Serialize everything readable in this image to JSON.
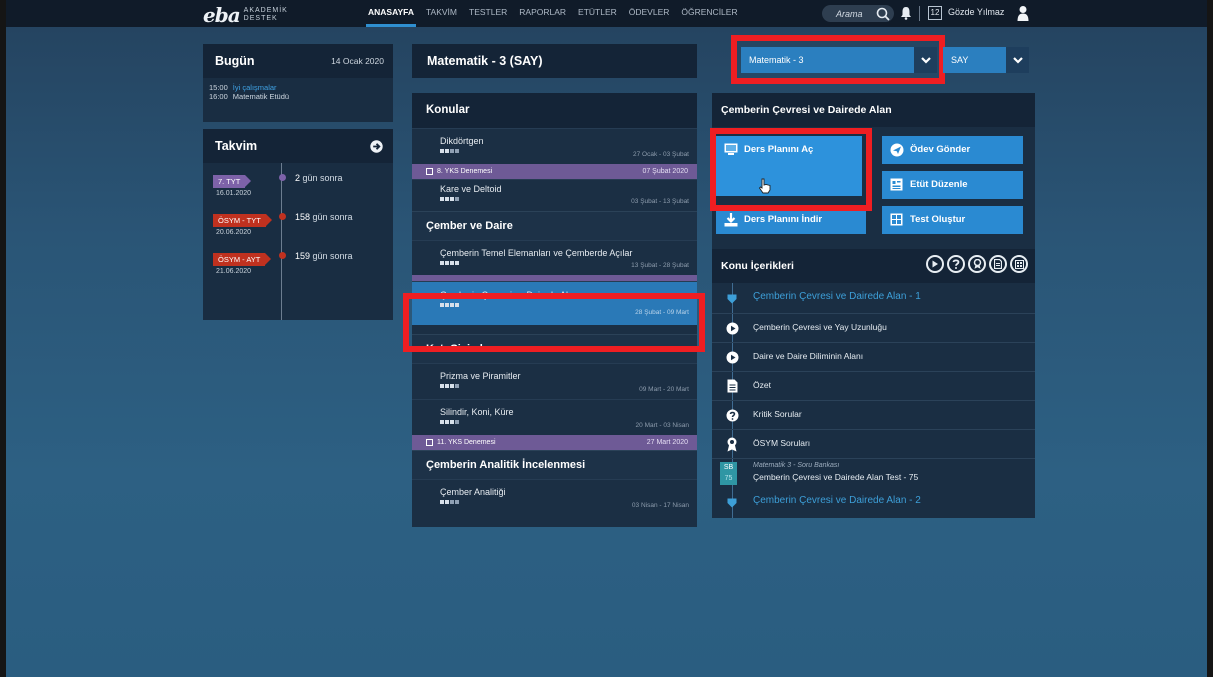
{
  "topbar": {
    "logo": "eba",
    "logo_sub1": "AKADEMİK",
    "logo_sub2": "DESTEK",
    "nav": [
      "ANASAYFA",
      "TAKVİM",
      "TESTLER",
      "RAPORLAR",
      "ETÜTLER",
      "ÖDEVLER",
      "ÖĞRENCİLER"
    ],
    "search_placeholder": "Arama",
    "notification_count": "12",
    "user_name": "Gözde Yılmaz"
  },
  "today": {
    "title": "Bugün",
    "date": "14 Ocak 2020",
    "items": [
      {
        "time": "15:00",
        "text": "İyi çalışmalar",
        "link": true
      },
      {
        "time": "16:00",
        "text": "Matematik Etüdü",
        "link": false
      }
    ]
  },
  "calendar": {
    "title": "Takvim",
    "events": [
      {
        "tag": "7. TYT",
        "date": "16.01.2020",
        "count": "2",
        "suffix": " gün sonra",
        "color": "#7d62a9"
      },
      {
        "tag": "ÖSYM - TYT",
        "date": "20.06.2020",
        "count": "158",
        "suffix": " gün sonra",
        "color": "#c0311f"
      },
      {
        "tag": "ÖSYM - AYT",
        "date": "21.06.2020",
        "count": "159",
        "suffix": " gün sonra",
        "color": "#c0311f"
      }
    ]
  },
  "course": {
    "title": "Matematik - 3 (SAY)",
    "select_value": "Matematik - 3",
    "select_type": "SAY"
  },
  "topics": {
    "title": "Konular",
    "item_dikdortgen": {
      "name": "Dikdörtgen",
      "range": "27 Ocak - 03 Şubat"
    },
    "exam8": {
      "name": "8. YKS Denemesi",
      "date": "07 Şubat 2020"
    },
    "item_kare": {
      "name": "Kare ve Deltoid",
      "range": "03 Şubat - 13 Şubat"
    },
    "sec_cember": "Çember ve Daire",
    "item_temel": {
      "name": "Çemberin Temel Elemanları ve Çemberde Açılar",
      "range": "13 Şubat - 28 Şubat"
    },
    "item_cevre": {
      "name": "Çemberin Çevresi ve Dairede Alan",
      "range": "28 Şubat - 09 Mart"
    },
    "sec_kati": "Katı Cisimler",
    "item_prizma": {
      "name": "Prizma ve Piramitler",
      "range": "09 Mart - 20 Mart"
    },
    "item_silindir": {
      "name": "Silindir, Koni, Küre",
      "range": "20 Mart - 03 Nisan"
    },
    "exam11": {
      "name": "11. YKS Denemesi",
      "date": "27 Mart 2020"
    },
    "sec_analitik": "Çemberin Analitik İncelenmesi",
    "item_analitik": {
      "name": "Çember Analitiği",
      "range": "03 Nisan - 17 Nisan"
    }
  },
  "detail": {
    "title": "Çemberin Çevresi ve Dairede Alan",
    "btn_open": "Ders Planını Aç",
    "btn_download": "Ders Planını İndir",
    "btn_homework": "Ödev Gönder",
    "btn_etut": "Etüt Düzenle",
    "btn_test": "Test Oluştur",
    "contents_title": "Konu İçerikleri",
    "sec1": "Çemberin Çevresi ve Dairede Alan - 1",
    "row_video1": "Çemberin Çevresi ve Yay Uzunluğu",
    "row_video2": "Daire ve Daire Diliminin Alanı",
    "row_ozet": "Özet",
    "row_kritik": "Kritik Sorular",
    "row_osym": "ÖSYM Soruları",
    "sb_label": "SB",
    "sb_num": "75",
    "sb_source": "Matematik 3 - Soru Bankası",
    "sb_title": "Çemberin Çevresi ve Dairede Alan Test - 75",
    "sec2": "Çemberin Çevresi ve Dairede Alan - 2"
  },
  "colors": {
    "accent": "#2a8ad2",
    "highlight": "#ef1e22",
    "exam": "#6e5a96"
  }
}
